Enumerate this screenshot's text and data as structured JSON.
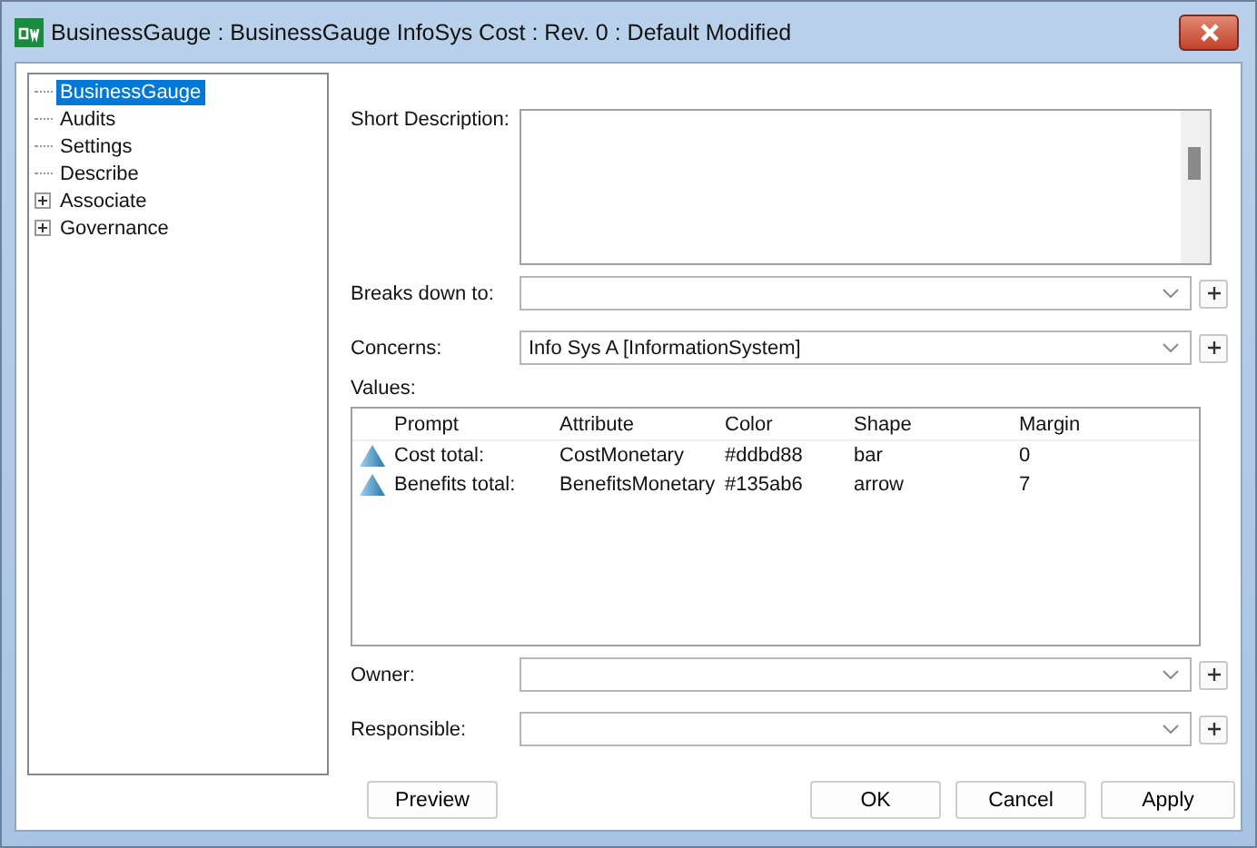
{
  "window": {
    "title": "BusinessGauge : BusinessGauge InfoSys Cost : Rev. 0 : Default Modified"
  },
  "tree": [
    {
      "label": "BusinessGauge",
      "selected": true,
      "expandable": false
    },
    {
      "label": "Audits",
      "selected": false,
      "expandable": false
    },
    {
      "label": "Settings",
      "selected": false,
      "expandable": false
    },
    {
      "label": "Describe",
      "selected": false,
      "expandable": false
    },
    {
      "label": "Associate",
      "selected": false,
      "expandable": true
    },
    {
      "label": "Governance",
      "selected": false,
      "expandable": true
    }
  ],
  "short_description": {
    "label": "Short Description:"
  },
  "breaks_down_to": {
    "label": "Breaks down to:"
  },
  "concerns": {
    "label": "Concerns:",
    "value": "Info Sys A [InformationSystem]"
  },
  "values": {
    "label": "Values:",
    "columns": [
      "Prompt",
      "Attribute",
      "Color",
      "Shape",
      "Margin"
    ],
    "rows": [
      {
        "cells": [
          "Cost total:",
          "CostMonetary",
          "#ddbd88",
          "bar",
          "0"
        ]
      },
      {
        "cells": [
          "Benefits total:",
          "BenefitsMonetary",
          "#135ab6",
          "arrow",
          "7"
        ]
      }
    ]
  },
  "owner": {
    "label": "Owner:"
  },
  "responsible": {
    "label": "Responsible:"
  },
  "buttons": {
    "left": [
      "Preview"
    ],
    "right": [
      "OK",
      "Cancel",
      "Apply"
    ]
  }
}
